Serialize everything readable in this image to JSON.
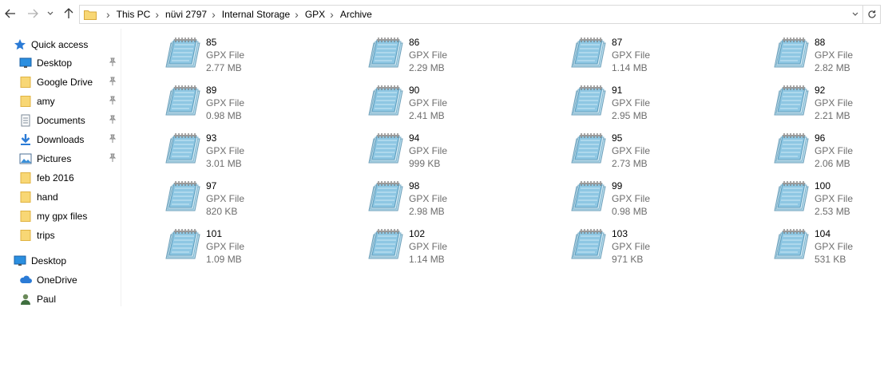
{
  "breadcrumb": [
    "This PC",
    "nüvi 2797",
    "Internal Storage",
    "GPX",
    "Archive"
  ],
  "sidebar": {
    "items": [
      {
        "label": "Quick access",
        "icon": "star-icon",
        "pinned": false,
        "indent": 1
      },
      {
        "label": "Desktop",
        "icon": "desktop-icon",
        "pinned": true,
        "indent": 2
      },
      {
        "label": "Google Drive",
        "icon": "folder-icon",
        "pinned": true,
        "indent": 2
      },
      {
        "label": "amy",
        "icon": "folder-icon",
        "pinned": true,
        "indent": 2
      },
      {
        "label": "Documents",
        "icon": "documents-icon",
        "pinned": true,
        "indent": 2
      },
      {
        "label": "Downloads",
        "icon": "download-icon",
        "pinned": true,
        "indent": 2
      },
      {
        "label": "Pictures",
        "icon": "pictures-icon",
        "pinned": true,
        "indent": 2
      },
      {
        "label": "feb 2016",
        "icon": "folder-icon",
        "pinned": false,
        "indent": 2
      },
      {
        "label": "hand",
        "icon": "folder-icon",
        "pinned": false,
        "indent": 2
      },
      {
        "label": "my gpx files",
        "icon": "folder-icon",
        "pinned": false,
        "indent": 2
      },
      {
        "label": "trips",
        "icon": "folder-icon",
        "pinned": false,
        "indent": 2
      },
      {
        "label": "Desktop",
        "icon": "desktop-icon",
        "pinned": false,
        "indent": 1
      },
      {
        "label": "OneDrive",
        "icon": "cloud-icon",
        "pinned": false,
        "indent": 2
      },
      {
        "label": "Paul",
        "icon": "user-icon",
        "pinned": false,
        "indent": 2
      }
    ]
  },
  "files": [
    {
      "name": "85",
      "type": "GPX File",
      "size": "2.77 MB"
    },
    {
      "name": "86",
      "type": "GPX File",
      "size": "2.29 MB"
    },
    {
      "name": "87",
      "type": "GPX File",
      "size": "1.14 MB"
    },
    {
      "name": "88",
      "type": "GPX File",
      "size": "2.82 MB"
    },
    {
      "name": "89",
      "type": "GPX File",
      "size": "0.98 MB"
    },
    {
      "name": "90",
      "type": "GPX File",
      "size": "2.41 MB"
    },
    {
      "name": "91",
      "type": "GPX File",
      "size": "2.95 MB"
    },
    {
      "name": "92",
      "type": "GPX File",
      "size": "2.21 MB"
    },
    {
      "name": "93",
      "type": "GPX File",
      "size": "3.01 MB"
    },
    {
      "name": "94",
      "type": "GPX File",
      "size": "999 KB"
    },
    {
      "name": "95",
      "type": "GPX File",
      "size": "2.73 MB"
    },
    {
      "name": "96",
      "type": "GPX File",
      "size": "2.06 MB"
    },
    {
      "name": "97",
      "type": "GPX File",
      "size": "820 KB"
    },
    {
      "name": "98",
      "type": "GPX File",
      "size": "2.98 MB"
    },
    {
      "name": "99",
      "type": "GPX File",
      "size": "0.98 MB"
    },
    {
      "name": "100",
      "type": "GPX File",
      "size": "2.53 MB"
    },
    {
      "name": "101",
      "type": "GPX File",
      "size": "1.09 MB"
    },
    {
      "name": "102",
      "type": "GPX File",
      "size": "1.14 MB"
    },
    {
      "name": "103",
      "type": "GPX File",
      "size": "971 KB"
    },
    {
      "name": "104",
      "type": "GPX File",
      "size": "531 KB"
    }
  ],
  "colors": {
    "folder": "#f8d775",
    "accent": "#0078d7",
    "notepad": "#6fb6d9"
  }
}
